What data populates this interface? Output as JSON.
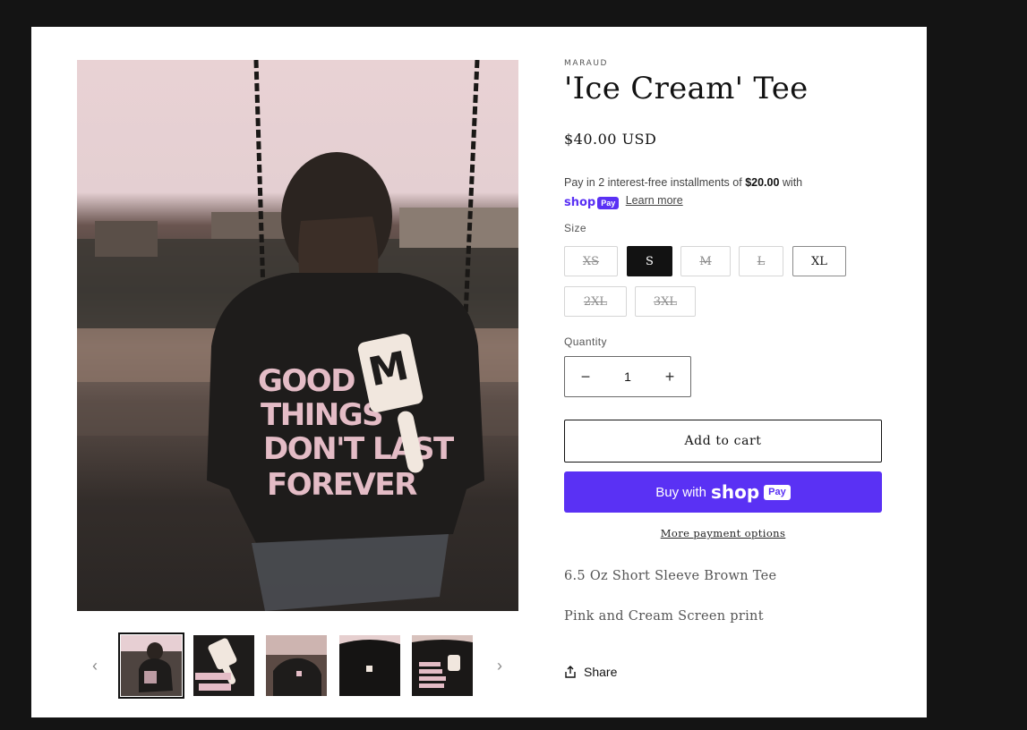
{
  "product": {
    "vendor": "MARAUD",
    "title": "'Ice Cream' Tee",
    "price": "$40.00 USD",
    "installments": {
      "prefix": "Pay in 2 interest-free installments of ",
      "amount": "$20.00",
      "suffix": " with",
      "shop_word": "shop",
      "pay_word": "Pay",
      "learn_more": "Learn more"
    },
    "size_label": "Size",
    "sizes": [
      {
        "label": "XS",
        "state": "sold-out"
      },
      {
        "label": "S",
        "state": "selected"
      },
      {
        "label": "M",
        "state": "sold-out"
      },
      {
        "label": "L",
        "state": "sold-out"
      },
      {
        "label": "XL",
        "state": "available"
      },
      {
        "label": "2XL",
        "state": "sold-out"
      },
      {
        "label": "3XL",
        "state": "sold-out"
      }
    ],
    "quantity_label": "Quantity",
    "quantity": "1",
    "minus_symbol": "−",
    "plus_symbol": "+",
    "add_to_cart": "Add to cart",
    "buy_with": "Buy with",
    "more_payment": "More payment options",
    "description": [
      "6.5 Oz Short Sleeve Brown Tee",
      "Pink and Cream Screen print"
    ],
    "share": "Share"
  },
  "media": {
    "print_text": [
      "GOOD",
      "THINGS",
      "DON'T LAST",
      "FOREVER"
    ],
    "thumbnail_count": 5,
    "active_thumbnail": 1,
    "prev_arrow": "‹",
    "next_arrow": "›"
  },
  "colors": {
    "page_bg": "#141414",
    "shop_pay_purple": "#5a31f4",
    "print_pink": "#e4bcc6",
    "selected_size": "#121212"
  }
}
